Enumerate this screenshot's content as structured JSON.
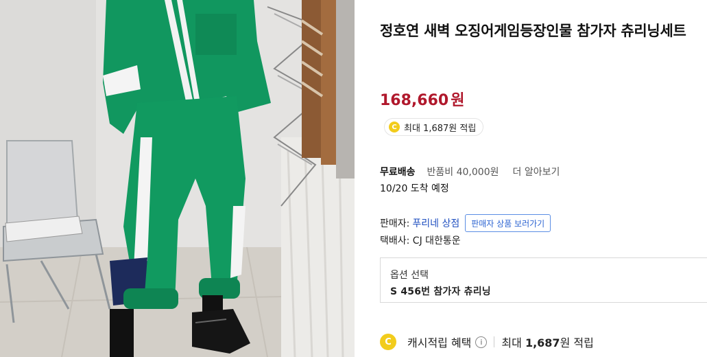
{
  "product": {
    "title": "정호연 새벽 오징어게임등장인물 참가자 츄리닝세트",
    "price": "168,660",
    "price_unit": "원",
    "point_pill": {
      "coin_symbol": "C",
      "text": "최대 1,687원 적립"
    }
  },
  "shipping": {
    "free_label": "무료배송",
    "return_fee": "반품비 40,000원",
    "more_link": "더 알아보기",
    "arrival": "10/20 도착 예정"
  },
  "seller": {
    "label": "판매자:",
    "name": "푸리네 상점",
    "view_button": "판매자 상품 보러가기",
    "courier": "택배사: CJ 대한통운"
  },
  "option": {
    "label": "옵션 선택",
    "selected": "S 456번 참가자 츄리닝"
  },
  "cash": {
    "coin_symbol": "C",
    "label": "캐시적립 혜택",
    "info_symbol": "i",
    "max_prefix": "최대",
    "max_amount": "1,687",
    "max_suffix": "원 적립"
  },
  "colors": {
    "price": "#b0182c",
    "coin": "#f2cc1c",
    "seller_link": "#1f4fc0",
    "suit_green": "#11975f"
  },
  "image": {
    "icon_name": "product-photo"
  }
}
